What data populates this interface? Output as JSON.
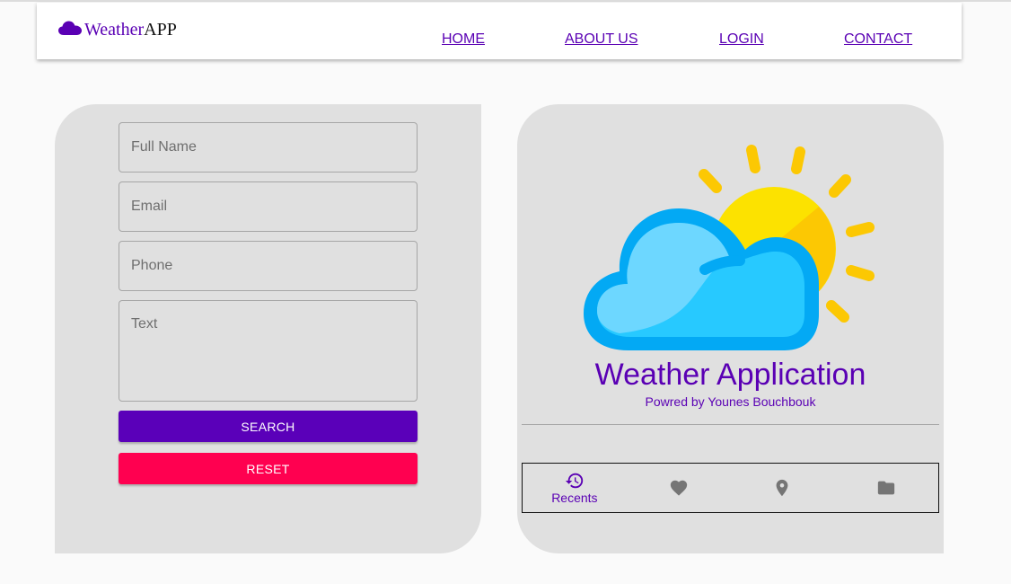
{
  "brand": {
    "part1": "Weather",
    "part2": "APP",
    "icon": "cloud-icon"
  },
  "nav": {
    "home": "HOME",
    "about": "ABOUT US",
    "login": "LOGIN",
    "contact": "CONTACT"
  },
  "form": {
    "full_name_placeholder": "Full Name",
    "email_placeholder": "Email",
    "phone_placeholder": "Phone",
    "text_placeholder": "Text",
    "search_label": "SEARCH",
    "reset_label": "RESET"
  },
  "hero": {
    "title": "Weather Application",
    "subtitle": "Powred by Younes Bouchbouk",
    "illustration": "sun-cloud-icon"
  },
  "bottom_nav": {
    "recents_label": "Recents",
    "items": [
      "history-icon",
      "heart-icon",
      "location-pin-icon",
      "folder-icon"
    ]
  },
  "colors": {
    "accent": "#5a00b4",
    "search": "#5a00b9",
    "reset": "#ff0050",
    "panel": "#e0e0e0",
    "icon_gray": "#757575"
  }
}
